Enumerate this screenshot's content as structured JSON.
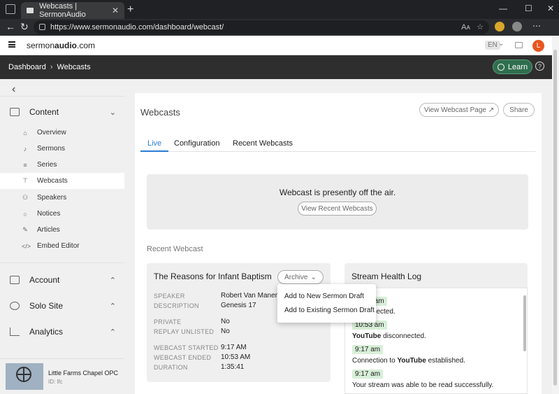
{
  "browser": {
    "tab_title": "Webcasts | SermonAudio",
    "url": "https://www.sermonaudio.com/dashboard/webcast/",
    "reader_label": "Aᴀ"
  },
  "site": {
    "logo_regular_1": "sermon",
    "logo_bold": "audio",
    "logo_regular_2": ".com",
    "lang": "EN",
    "avatar_letter": "L"
  },
  "breadcrumb": {
    "root": "Dashboard",
    "current": "Webcasts",
    "learn": "Learn",
    "help": "?"
  },
  "sidebar": {
    "content_label": "Content",
    "items": [
      {
        "label": "Overview",
        "icon": "home-icon"
      },
      {
        "label": "Sermons",
        "icon": "mic-icon"
      },
      {
        "label": "Series",
        "icon": "list-icon"
      },
      {
        "label": "Webcasts",
        "icon": "broadcast-icon"
      },
      {
        "label": "Speakers",
        "icon": "speakers-icon"
      },
      {
        "label": "Notices",
        "icon": "chat-icon"
      },
      {
        "label": "Articles",
        "icon": "pen-icon"
      },
      {
        "label": "Embed Editor",
        "icon": "code-icon"
      }
    ],
    "account_label": "Account",
    "solosite_label": "Solo Site",
    "analytics_label": "Analytics",
    "church_name": "Little Farms Chapel OPC",
    "church_id": "ID: lfc"
  },
  "page": {
    "title": "Webcasts",
    "view_page_btn": "View Webcast Page",
    "share_btn": "Share",
    "tabs": [
      "Live",
      "Configuration",
      "Recent Webcasts"
    ],
    "off_air_message": "Webcast is presently off the air.",
    "view_recent_btn": "View Recent Webcasts",
    "recent_label": "Recent Webcast"
  },
  "webcast": {
    "title": "The Reasons for Infant Baptism",
    "archive_btn": "Archive",
    "speaker_label": "SPEAKER",
    "speaker": "Robert Van Manen",
    "description_label": "DESCRIPTION",
    "description": "Genesis 17",
    "private_label": "PRIVATE",
    "private": "No",
    "replay_label": "REPLAY UNLISTED",
    "replay": "No",
    "started_label": "WEBCAST STARTED",
    "started": "9:17 AM",
    "ended_label": "WEBCAST ENDED",
    "ended": "10:53 AM",
    "duration_label": "DURATION",
    "duration": "1:35:41"
  },
  "archive_menu": {
    "new_draft": "Add to New Sermon Draft",
    "existing_draft": "Add to Existing Sermon Draft"
  },
  "health_log": {
    "title": "Stream Health Log",
    "entries": [
      {
        "time": "10:53 am",
        "text_pre": "",
        "text_bold": "",
        "text_post": "disconnected."
      },
      {
        "time": "10:53 am",
        "text_pre": "",
        "text_bold": "YouTube",
        "text_post": " disconnected."
      },
      {
        "time": "9:17 am",
        "text_pre": "Connection to ",
        "text_bold": "YouTube",
        "text_post": " established."
      },
      {
        "time": "9:17 am",
        "text_pre": "Your stream was able to be read successfully.",
        "text_bold": "",
        "text_post": ""
      }
    ]
  },
  "colors": {
    "accent_blue": "#2b7cd3",
    "learn_green": "#2f6e4e",
    "avatar_orange": "#e8551f",
    "timestamp_green": "#d8efd9"
  }
}
